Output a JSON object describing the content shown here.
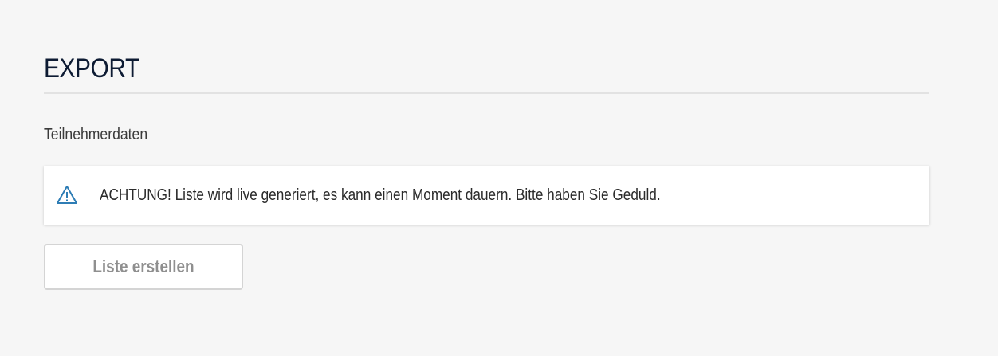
{
  "page": {
    "title": "EXPORT",
    "section_label": "Teilnehmerdaten"
  },
  "alert": {
    "icon": "warning-triangle-icon",
    "icon_color": "#2e7db5",
    "message": "ACHTUNG! Liste wird live generiert, es kann einen Moment dauern. Bitte haben Sie Geduld."
  },
  "actions": {
    "create_list_label": "Liste erstellen"
  }
}
